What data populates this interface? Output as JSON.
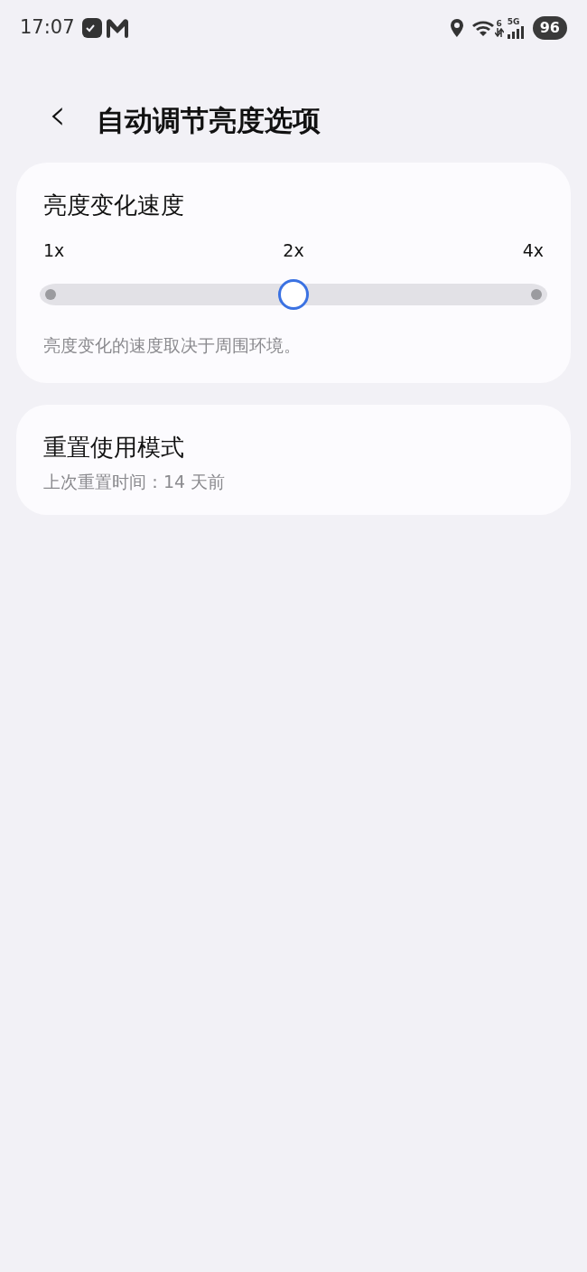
{
  "status_bar": {
    "time": "17:07",
    "wifi_label": "6",
    "network": "5G",
    "battery": "96"
  },
  "header": {
    "back": "‹",
    "title": "自动调节亮度选项"
  },
  "speed_card": {
    "title": "亮度变化速度",
    "ticks": [
      "1x",
      "2x",
      "4x"
    ],
    "level": 0.5,
    "description": "亮度变化的速度取决于周围环境。"
  },
  "reset_card": {
    "title": "重置使用模式",
    "subtitle": "上次重置时间：14 天前"
  }
}
